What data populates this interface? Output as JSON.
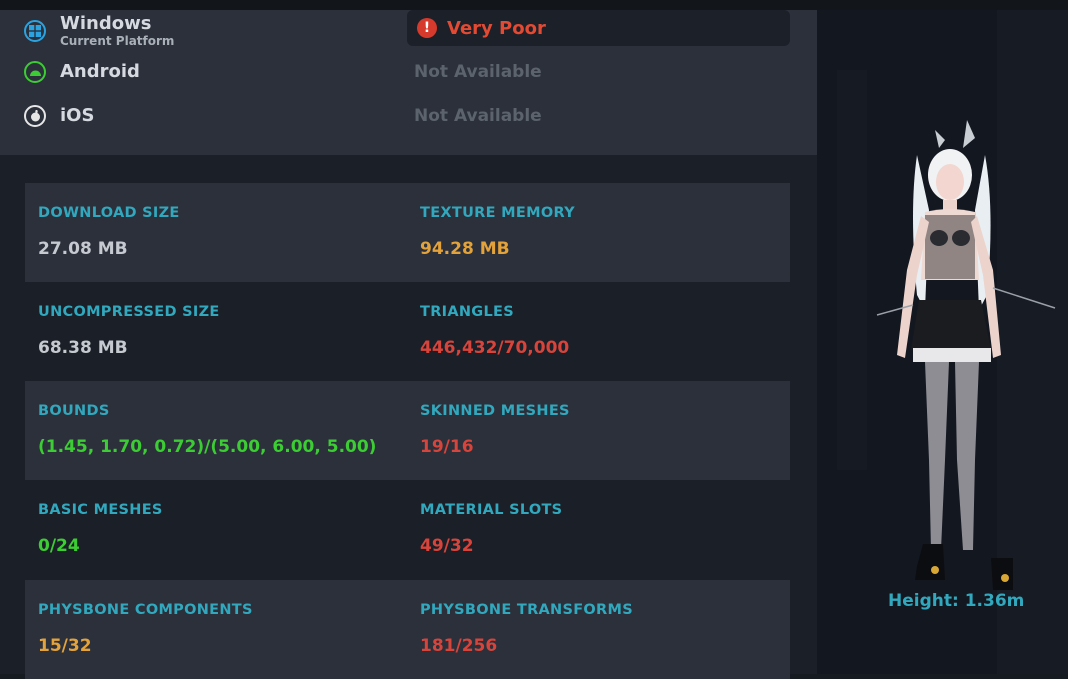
{
  "platforms": [
    {
      "name": "Windows",
      "sub": "Current Platform",
      "icon": "windows-icon",
      "status": "Very Poor"
    },
    {
      "name": "Android",
      "icon": "android-icon",
      "status": "Not Available"
    },
    {
      "name": "iOS",
      "icon": "apple-icon",
      "status": "Not Available"
    }
  ],
  "stats": {
    "download_size": {
      "label": "DOWNLOAD SIZE",
      "value": "27.08 MB"
    },
    "texture_memory": {
      "label": "TEXTURE MEMORY",
      "value": "94.28 MB"
    },
    "uncompressed_size": {
      "label": "UNCOMPRESSED SIZE",
      "value": "68.38 MB"
    },
    "triangles": {
      "label": "TRIANGLES",
      "value": "446,432/70,000"
    },
    "bounds": {
      "label": "BOUNDS",
      "value": "(1.45, 1.70, 0.72)/(5.00, 6.00, 5.00)"
    },
    "skinned_meshes": {
      "label": "SKINNED MESHES",
      "value": "19/16"
    },
    "basic_meshes": {
      "label": "BASIC MESHES",
      "value": "0/24"
    },
    "material_slots": {
      "label": "MATERIAL SLOTS",
      "value": "49/32"
    },
    "physbone_components": {
      "label": "PHYSBONE COMPONENTS",
      "value": "15/32"
    },
    "physbone_transforms": {
      "label": "PHYSBONE TRANSFORMS",
      "value": "181/256"
    }
  },
  "preview": {
    "height_label": "Height: 1.36m"
  },
  "colors": {
    "accent": "#31a8bd",
    "good": "#3ccc33",
    "medium": "#e3a23a",
    "poor": "#d7443b"
  }
}
